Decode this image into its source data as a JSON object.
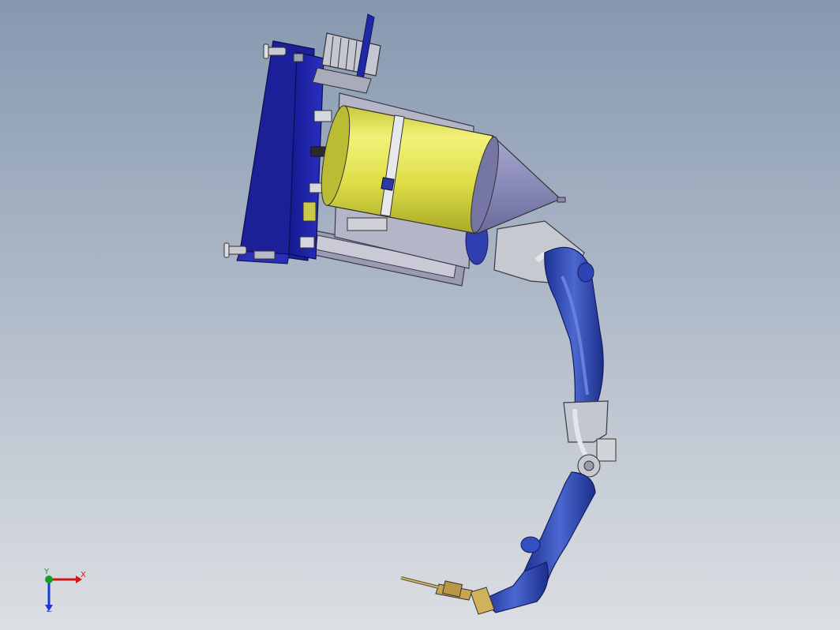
{
  "viewport": {
    "background_top": "#8698b0",
    "background_bottom": "#dcdfe3"
  },
  "model": {
    "colors": {
      "mount_plate": "#1f23a8",
      "frame_gray": "#9fa0b2",
      "yellow_cylinder": "#e2e24a",
      "cone": "#8686b0",
      "arm_blue": "#2d46b8",
      "arm_highlight": "#5d77d6",
      "joint_gray": "#b8bcc4",
      "torch_gold": "#d0b25a"
    }
  },
  "triad": {
    "x_label": "X",
    "y_label": "Y",
    "z_label": "Z",
    "x_color": "#d01818",
    "y_color": "#16a028",
    "z_color": "#1a3ad0"
  }
}
